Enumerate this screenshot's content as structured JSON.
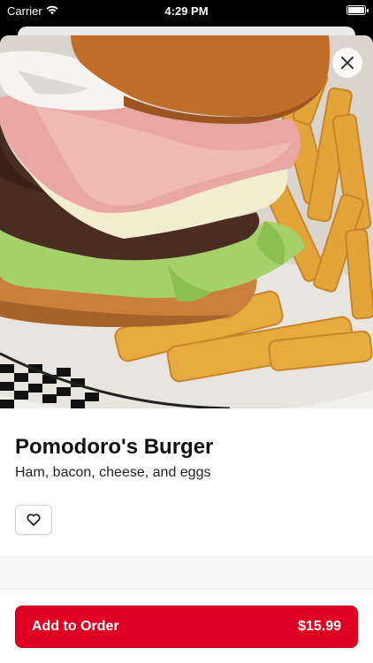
{
  "status_bar": {
    "carrier": "Carrier",
    "time": "4:29 PM",
    "battery_level": 1.0
  },
  "item": {
    "name": "Pomodoro's Burger",
    "description": "Ham, bacon, cheese, and eggs",
    "image_alt": "burger-with-fries-photo"
  },
  "actions": {
    "close_icon": "close-icon",
    "favorite_icon": "heart-icon",
    "add_to_order_label": "Add to Order",
    "price": "$15.99"
  },
  "colors": {
    "accent": "#e00024",
    "background": "#ffffff"
  }
}
